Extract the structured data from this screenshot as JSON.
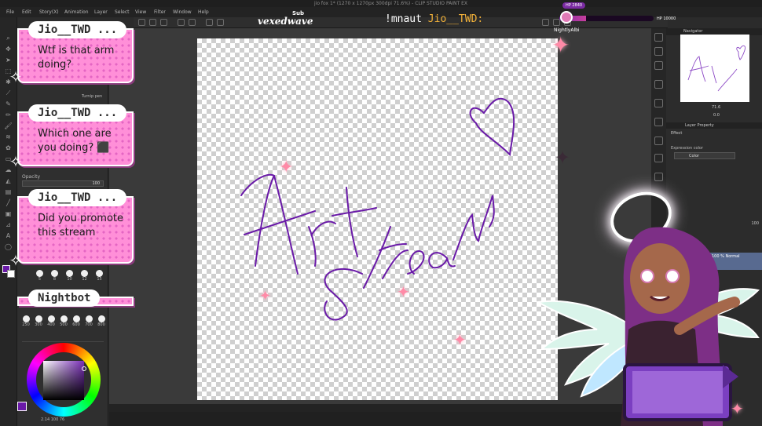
{
  "app": {
    "window_title": "jio fox 1* (1270 x 1270px 300dpi 71.6%) - CLIP STUDIO PAINT EX",
    "menu": [
      "File",
      "Edit",
      "Story(X)",
      "Animation",
      "Layer",
      "Select",
      "View",
      "Filter",
      "Window",
      "Help"
    ]
  },
  "stream": {
    "sub_label": "Sub",
    "sub_name": "vexedwave",
    "current_prefix": "!mnaut",
    "current_user": "Jio__TWD:",
    "hp_left": "HP 2840",
    "hp_right": "HP 10000",
    "hp_fraction": 0.28,
    "viewer_name": "NightlyAlbi"
  },
  "chat": [
    {
      "user": "Jio__TWD ...",
      "message": "Wtf is that arm doing?"
    },
    {
      "user": "Jio__TWD ...",
      "message": "Which one are you doing? ⬛"
    },
    {
      "user": "Jio__TWD ...",
      "message": "Did you promote this stream"
    },
    {
      "user": "Nightbot",
      "message": ""
    }
  ],
  "tool_panel": {
    "tool_name": "Turnip pen",
    "opacity_label": "Opacity",
    "opacity_value": "100",
    "brush_sizes_row1": [
      "5",
      "8",
      "10",
      "12",
      "15"
    ],
    "brush_sizes_row2": [
      "250",
      "300",
      "400",
      "500",
      "600",
      "700",
      "800"
    ],
    "color_readout": "2.14 100 76"
  },
  "canvas": {
    "art_line1": "Art",
    "art_line2": "Stream"
  },
  "right_panel": {
    "navigator_tab": "Navigator",
    "zoom": "71.6",
    "rotation": "0.0",
    "layer_property_tab": "Layer Property",
    "effect_label": "Effect",
    "expression_color_label": "Expression color",
    "expression_color_value": "Color",
    "layer_blend": "100 % Normal",
    "layer_opacity": "100"
  },
  "colors": {
    "chat_bg": "#ff8fd8",
    "ink": "#6a1aa8",
    "accent_gold": "#f3b23a"
  }
}
